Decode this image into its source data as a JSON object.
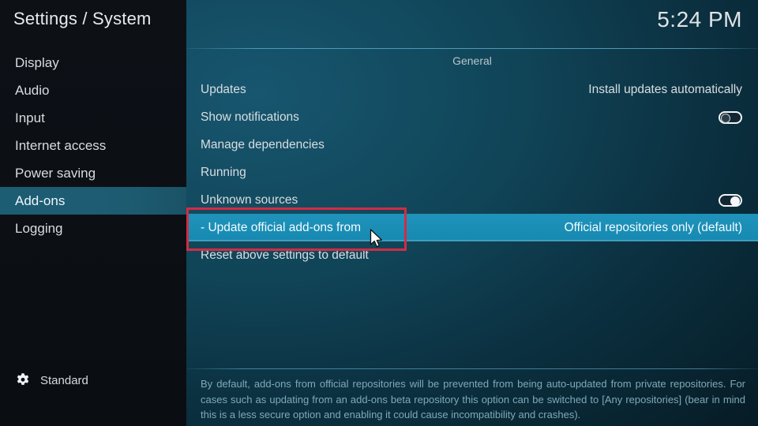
{
  "app": {
    "title": "Settings / System",
    "clock": "5:24 PM"
  },
  "colors": {
    "accent": "#1a8cb4",
    "sidebar_selected": "#1d5d74",
    "annotation": "#d32b44",
    "description_text": "#7fa9b8"
  },
  "sidebar": {
    "items": [
      {
        "label": "Display",
        "selected": false
      },
      {
        "label": "Audio",
        "selected": false
      },
      {
        "label": "Input",
        "selected": false
      },
      {
        "label": "Internet access",
        "selected": false
      },
      {
        "label": "Power saving",
        "selected": false
      },
      {
        "label": "Add-ons",
        "selected": true
      },
      {
        "label": "Logging",
        "selected": false
      }
    ],
    "profile": {
      "icon": "gear-icon",
      "label": "Standard"
    }
  },
  "main": {
    "group_title": "General",
    "rows": [
      {
        "label": "Updates",
        "value": "Install updates automatically",
        "control": "value",
        "selected": false
      },
      {
        "label": "Show notifications",
        "value": "",
        "control": "toggle",
        "toggle_state": "off",
        "selected": false
      },
      {
        "label": "Manage dependencies",
        "value": "",
        "control": "none",
        "selected": false
      },
      {
        "label": "Running",
        "value": "",
        "control": "none",
        "selected": false
      },
      {
        "label": "Unknown sources",
        "value": "",
        "control": "toggle",
        "toggle_state": "on",
        "selected": false
      },
      {
        "label": "- Update official add-ons from",
        "value": "Official repositories only (default)",
        "control": "value",
        "selected": true
      },
      {
        "label": "Reset above settings to default",
        "value": "",
        "control": "none",
        "selected": false
      }
    ],
    "description": "By default, add-ons from official repositories will be prevented from being auto-updated from private repositories. For cases such as updating from an add-ons beta repository this option can be switched to [Any repositories] (bear in mind this is a less secure option and enabling it could cause incompatibility and crashes)."
  },
  "annotation": {
    "type": "red-rectangle-highlight",
    "target_row": "- Update official add-ons from"
  },
  "cursor": {
    "icon": "arrow-pointer-icon"
  }
}
